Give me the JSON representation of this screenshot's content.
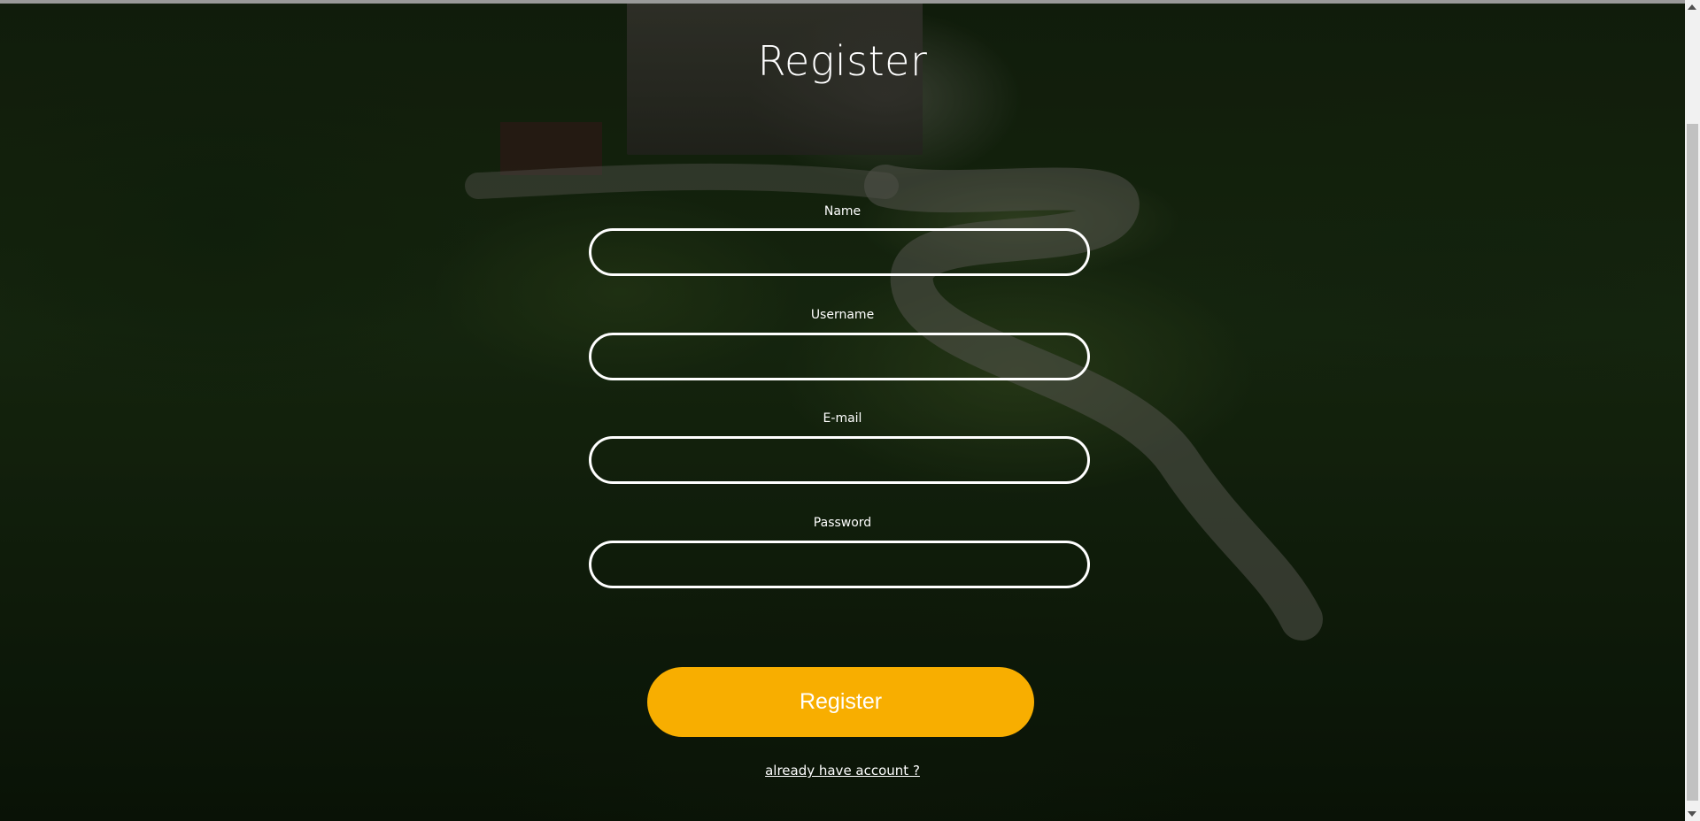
{
  "page": {
    "title": "Register"
  },
  "form": {
    "fields": [
      {
        "label": "Name",
        "value": ""
      },
      {
        "label": "Username",
        "value": ""
      },
      {
        "label": "E-mail",
        "value": ""
      },
      {
        "label": "Password",
        "value": ""
      }
    ],
    "submit_label": "Register",
    "login_link": "already have account ?"
  },
  "colors": {
    "accent": "#f8ae00",
    "text": "#ffffff",
    "field_border": "#ffffff"
  }
}
